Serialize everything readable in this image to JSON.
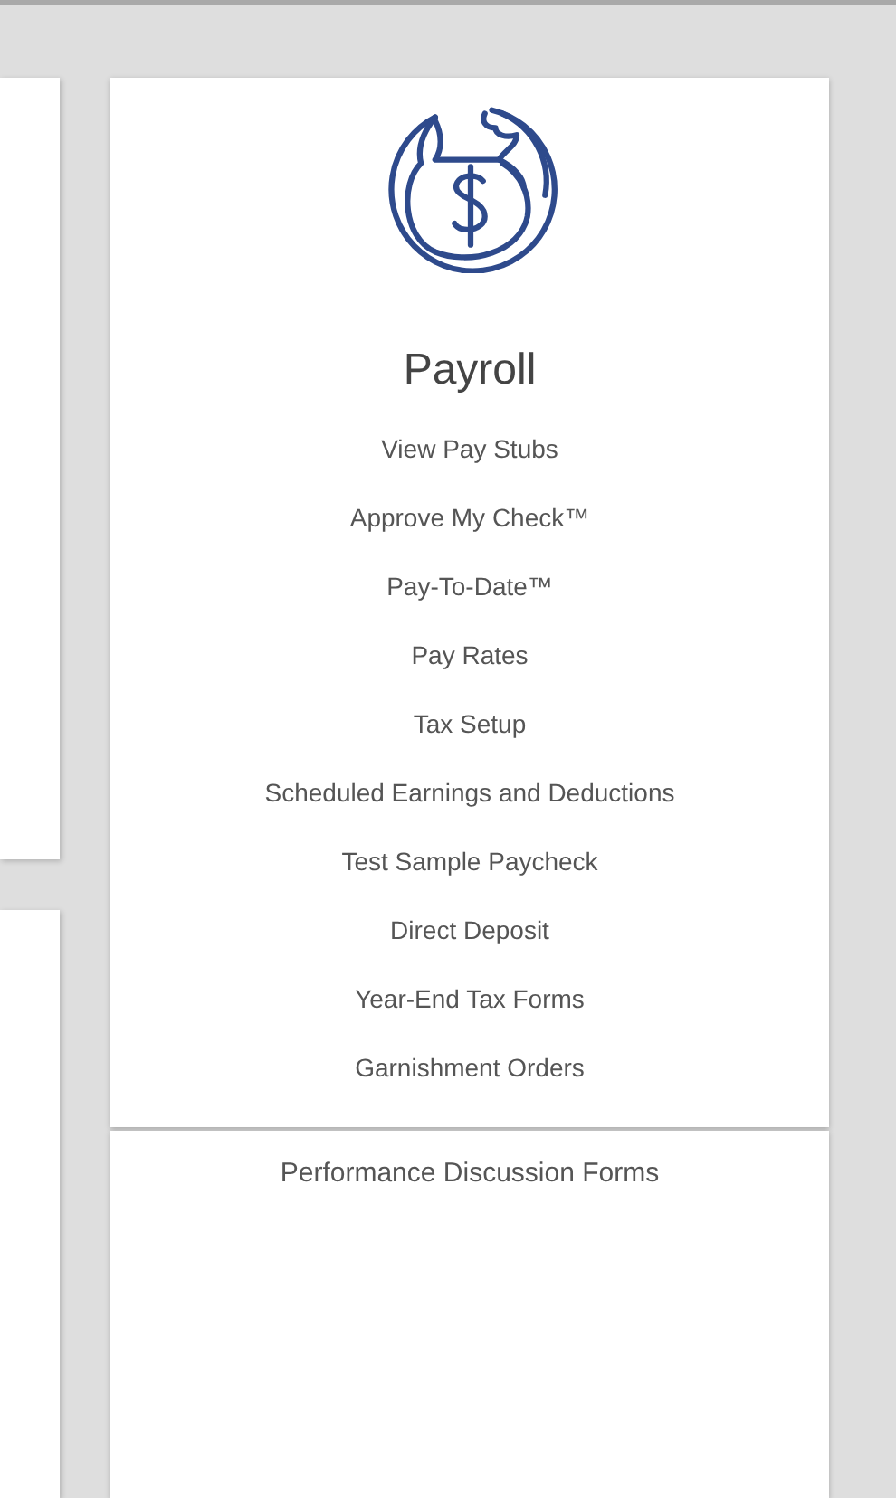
{
  "card": {
    "title": "Payroll",
    "links": [
      "View Pay Stubs",
      "Approve My Check™",
      "Pay-To-Date™",
      "Pay Rates",
      "Tax Setup",
      "Scheduled Earnings and Deductions",
      "Test Sample Paycheck",
      "Direct Deposit",
      "Year-End Tax Forms",
      "Garnishment Orders"
    ]
  },
  "next_card": {
    "link": "Performance Discussion Forms"
  }
}
